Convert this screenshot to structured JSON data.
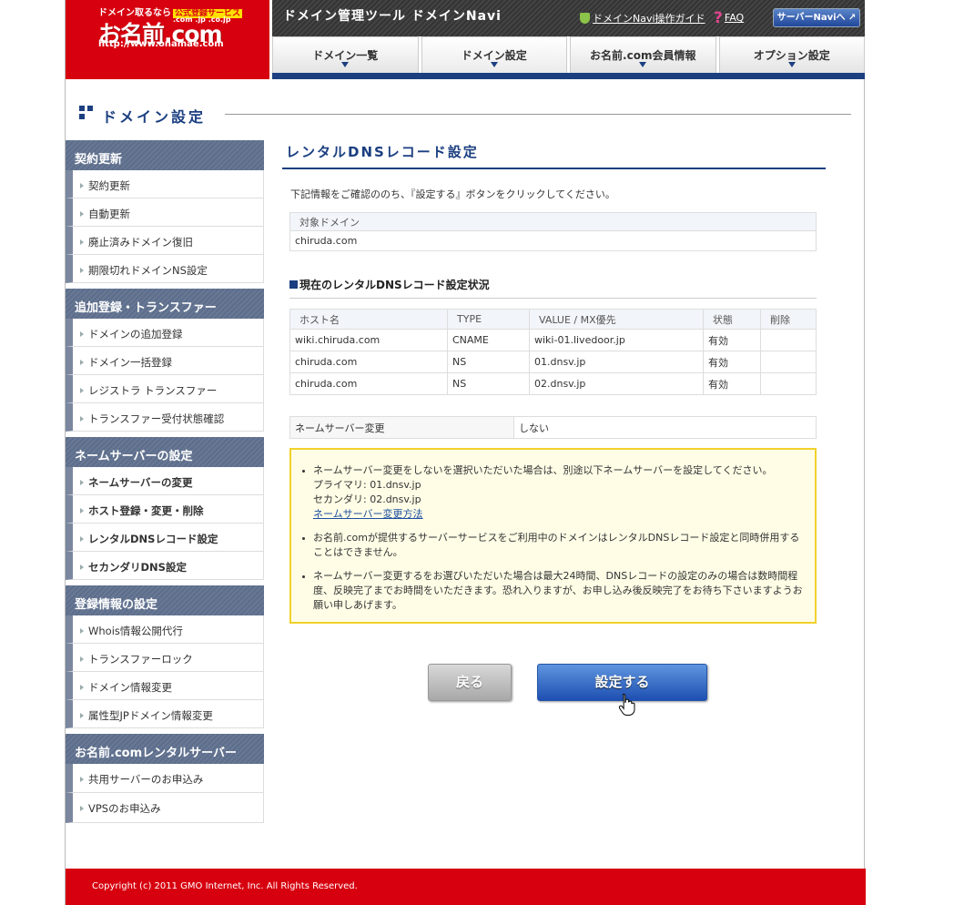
{
  "logo": {
    "tag": "ドメイン取るなら",
    "badge": "公式登録サービス",
    "tlds": ".com .jp .co.jp",
    "brand": "お名前.com",
    "url": "http://www.onamae.com"
  },
  "header": {
    "title": "ドメイン管理ツール ドメインNavi",
    "guide_link": "ドメインNavi操作ガイド",
    "faq_link": "FAQ",
    "server_navi_button": "サーバーNaviへ ↗"
  },
  "nav": {
    "tabs": [
      {
        "label": "ドメイン一覧"
      },
      {
        "label": "ドメイン設定"
      },
      {
        "label": "お名前.com会員情報"
      },
      {
        "label": "オプション設定"
      }
    ],
    "active": "ドメイン設定"
  },
  "page_title": "ドメイン設定",
  "sidebar": {
    "groups": [
      {
        "title": "契約更新",
        "items": [
          "契約更新",
          "自動更新",
          "廃止済みドメイン復旧",
          "期限切れドメインNS設定"
        ]
      },
      {
        "title": "追加登録・トランスファー",
        "items": [
          "ドメインの追加登録",
          "ドメイン一括登録",
          "レジストラ トランスファー",
          "トランスファー受付状態確認"
        ]
      },
      {
        "title": "ネームサーバーの設定",
        "items": [
          "ネームサーバーの変更",
          "ホスト登録・変更・削除",
          "レンタルDNSレコード設定",
          "セカンダリDNS設定"
        ]
      },
      {
        "title": "登録情報の設定",
        "items": [
          "Whois情報公開代行",
          "トランスファーロック",
          "ドメイン情報変更",
          "属性型JPドメイン情報変更"
        ]
      },
      {
        "title": "お名前.comレンタルサーバー",
        "items": [
          "共用サーバーのお申込み",
          "VPSのお申込み"
        ]
      }
    ]
  },
  "main": {
    "heading": "レンタルDNSレコード設定",
    "intro": "下記情報をご確認ののち、『設定する』ボタンをクリックしてください。",
    "target_label": "対象ドメイン",
    "target_value": "chiruda.com",
    "section_title": "現在のレンタルDNSレコード設定状況",
    "records": {
      "headers": [
        "ホスト名",
        "TYPE",
        "VALUE / MX優先",
        "状態",
        "削除"
      ],
      "rows": [
        [
          "wiki.chiruda.com",
          "CNAME",
          "wiki-01.livedoor.jp",
          "有効",
          ""
        ],
        [
          "chiruda.com",
          "NS",
          "01.dnsv.jp",
          "有効",
          ""
        ],
        [
          "chiruda.com",
          "NS",
          "02.dnsv.jp",
          "有効",
          ""
        ]
      ]
    },
    "ns_change_label": "ネームサーバー変更",
    "ns_change_value": "しない",
    "notice": {
      "item1": "ネームサーバー変更をしないを選択いただいた場合は、別途以下ネームサーバーを設定してください。",
      "primary": "プライマリ:  01.dnsv.jp",
      "secondary": "セカンダリ:  02.dnsv.jp",
      "link": "ネームサーバー変更方法",
      "item2": "お名前.comが提供するサーバーサービスをご利用中のドメインはレンタルDNSレコード設定と同時併用することはできません。",
      "item3": "ネームサーバー変更するをお選びいただいた場合は最大24時間、DNSレコードの設定のみの場合は数時間程度、反映完了までお時間をいただきます。恐れ入りますが、お申し込み後反映完了をお待ち下さいますようお願い申しあげます。"
    },
    "back_button": "戻る",
    "submit_button": "設定する"
  },
  "footer": "Copyright (c) 2011 GMO Internet, Inc. All Rights Reserved.",
  "colors": {
    "brand_red": "#d7000f",
    "navy": "#1b3f80",
    "notice_border": "#f2d12b"
  }
}
